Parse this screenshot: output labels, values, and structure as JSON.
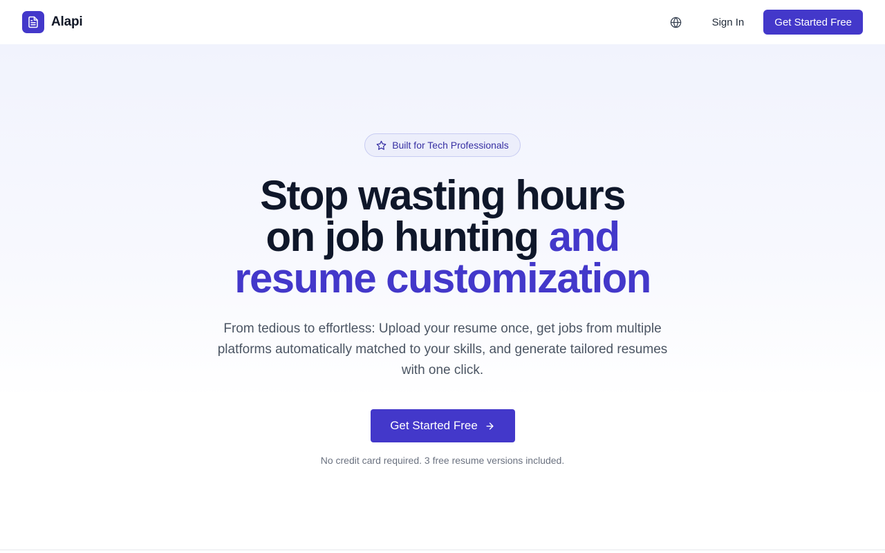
{
  "navbar": {
    "brand_name": "Alapi",
    "logo_icon": "document-icon",
    "globe_icon": "globe-icon",
    "signin_label": "Sign In",
    "cta_label": "Get Started Free"
  },
  "hero": {
    "badge_icon": "star-icon",
    "badge_label": "Built for Tech Professionals",
    "headline_line1": "Stop wasting hours",
    "headline_line2_dark": "on job hunting ",
    "headline_line2_accent": "and",
    "headline_line3": "resume customization",
    "subtext": "From tedious to effortless: Upload your resume once, get jobs from multiple platforms automatically matched to your skills, and generate tailored resumes with one click.",
    "cta_label": "Get Started Free",
    "cta_icon": "arrow-right-icon",
    "note": "No credit card required. 3 free resume versions included."
  },
  "colors": {
    "accent": "#4338ca",
    "headline": "#0f172a",
    "body_text": "#4b5563",
    "muted_text": "#6b7280"
  }
}
